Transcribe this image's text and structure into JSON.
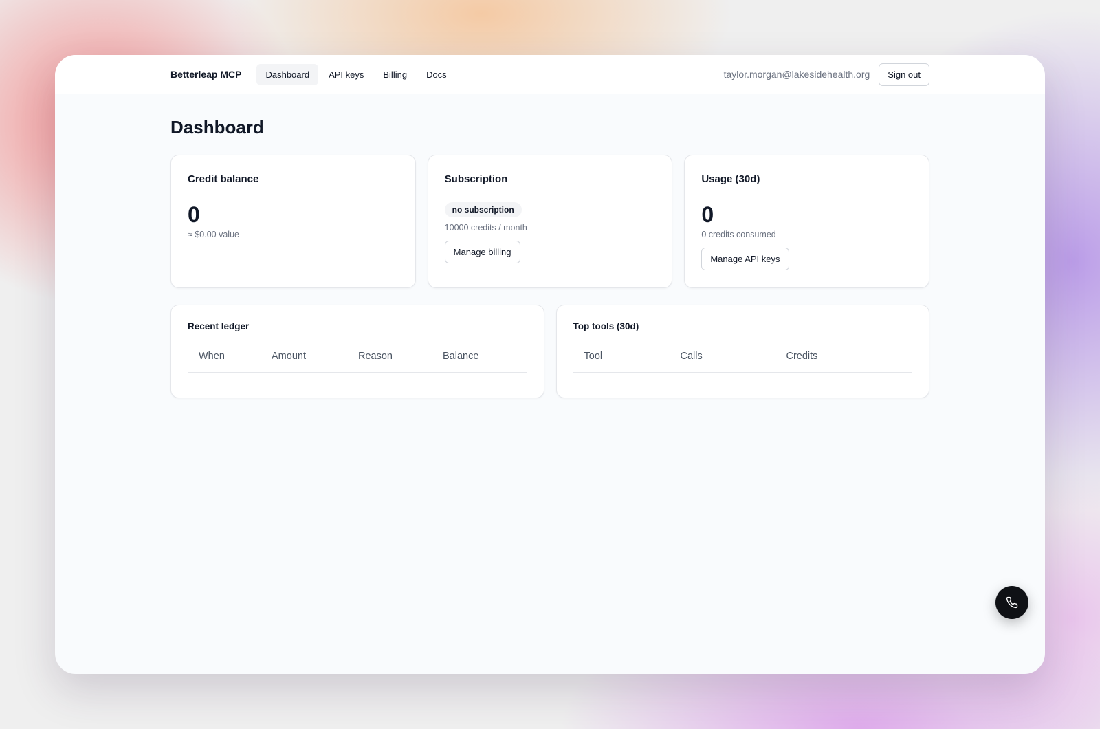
{
  "nav": {
    "brand": "Betterleap MCP",
    "items": [
      {
        "label": "Dashboard",
        "active": true
      },
      {
        "label": "API keys",
        "active": false
      },
      {
        "label": "Billing",
        "active": false
      },
      {
        "label": "Docs",
        "active": false
      }
    ],
    "user_email": "taylor.morgan@lakesidehealth.org",
    "sign_out_label": "Sign out"
  },
  "page": {
    "title": "Dashboard"
  },
  "credit_balance": {
    "title": "Credit balance",
    "value": "0",
    "subtext": "≈ $0.00 value"
  },
  "subscription": {
    "title": "Subscription",
    "status_badge": "no subscription",
    "plan_text": "10000 credits / month",
    "button_label": "Manage billing"
  },
  "usage": {
    "title": "Usage (30d)",
    "value": "0",
    "subtext": "0 credits consumed",
    "button_label": "Manage API keys"
  },
  "recent_ledger": {
    "title": "Recent ledger",
    "columns": [
      "When",
      "Amount",
      "Reason",
      "Balance"
    ],
    "rows": []
  },
  "top_tools": {
    "title": "Top tools (30d)",
    "columns": [
      "Tool",
      "Calls",
      "Credits"
    ],
    "rows": []
  },
  "fab": {
    "icon": "phone-icon"
  }
}
